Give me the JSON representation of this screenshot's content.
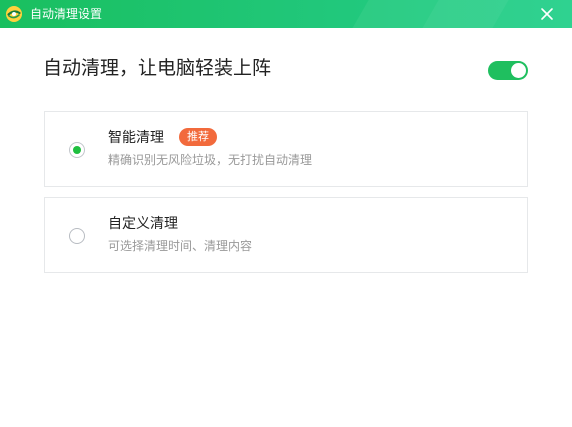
{
  "window": {
    "title": "自动清理设置",
    "logo_icon": "qihoo-360-logo-icon",
    "close_icon": "close-icon"
  },
  "header": {
    "text": "自动清理，让电脑轻装上阵",
    "toggle_on": true
  },
  "options": [
    {
      "title": "智能清理",
      "badge": "推荐",
      "desc": "精确识别无风险垃圾，无打扰自动清理",
      "selected": true
    },
    {
      "title": "自定义清理",
      "desc": "可选择清理时间、清理内容",
      "selected": false
    }
  ],
  "colors": {
    "accent_green": "#1fbf5f",
    "badge_orange": "#f26a3c"
  }
}
